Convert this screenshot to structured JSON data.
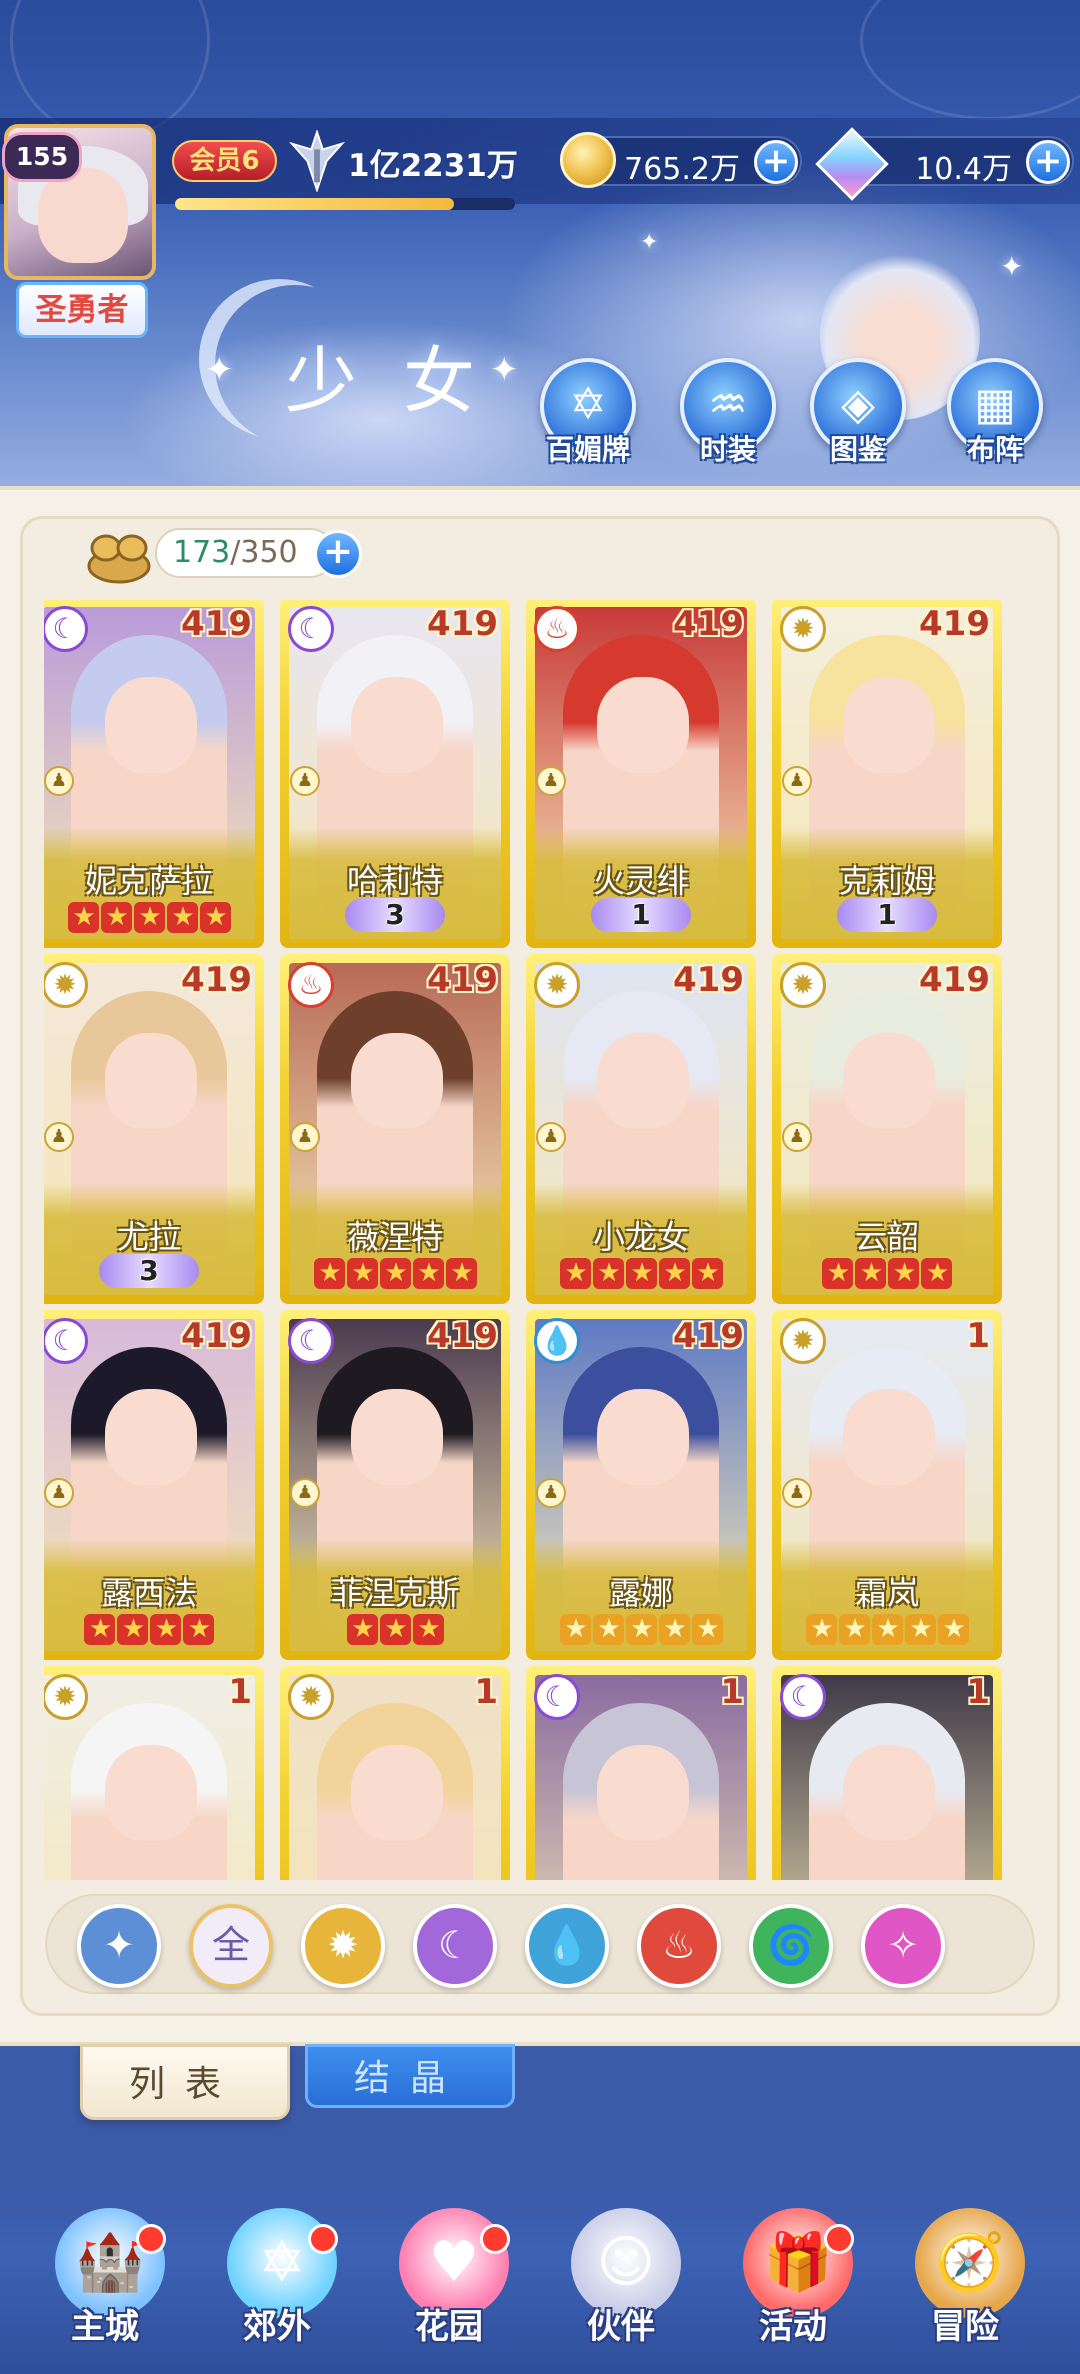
{
  "header": {
    "player_level": "155",
    "player_title": "圣勇者",
    "vip_label": "会员6",
    "power": "1亿2231万",
    "gold": "765.2万",
    "diamond": "10.4万",
    "add_symbol": "+",
    "xp_fraction": 0.82
  },
  "page_title": "少女",
  "top_nav": [
    {
      "label": "百媚牌",
      "icon": "star-badge-icon"
    },
    {
      "label": "时装",
      "icon": "dress-icon"
    },
    {
      "label": "图鉴",
      "icon": "book-icon"
    },
    {
      "label": "布阵",
      "icon": "grid-icon"
    }
  ],
  "capacity": {
    "current": "173",
    "separator": "/",
    "max": "350"
  },
  "cards": [
    {
      "name": "妮克萨拉",
      "level": "419",
      "element": "moon",
      "stars": 5,
      "star_type": "red",
      "wing": ""
    },
    {
      "name": "哈莉特",
      "level": "419",
      "element": "moon",
      "stars": 0,
      "star_type": "",
      "wing": "3"
    },
    {
      "name": "火灵绯",
      "level": "419",
      "element": "fire",
      "stars": 0,
      "star_type": "",
      "wing": "1"
    },
    {
      "name": "克莉姆",
      "level": "419",
      "element": "sun",
      "stars": 0,
      "star_type": "",
      "wing": "1"
    },
    {
      "name": "尤拉",
      "level": "419",
      "element": "sun",
      "stars": 0,
      "star_type": "",
      "wing": "3"
    },
    {
      "name": "薇涅特",
      "level": "419",
      "element": "fire",
      "stars": 5,
      "star_type": "red",
      "wing": ""
    },
    {
      "name": "小龙女",
      "level": "419",
      "element": "sun",
      "stars": 5,
      "star_type": "red",
      "wing": ""
    },
    {
      "name": "云韶",
      "level": "419",
      "element": "sun",
      "stars": 4,
      "star_type": "red",
      "wing": ""
    },
    {
      "name": "露西法",
      "level": "419",
      "element": "moon",
      "stars": 4,
      "star_type": "red",
      "wing": ""
    },
    {
      "name": "菲涅克斯",
      "level": "419",
      "element": "moon",
      "stars": 3,
      "star_type": "red",
      "wing": ""
    },
    {
      "name": "露娜",
      "level": "419",
      "element": "water",
      "stars": 5,
      "star_type": "gold",
      "wing": ""
    },
    {
      "name": "霜岚",
      "level": "1",
      "element": "sun",
      "stars": 5,
      "star_type": "gold",
      "wing": ""
    },
    {
      "name": "",
      "level": "1",
      "element": "sun",
      "stars": 0,
      "star_type": "",
      "wing": ""
    },
    {
      "name": "",
      "level": "1",
      "element": "sun",
      "stars": 0,
      "star_type": "",
      "wing": ""
    },
    {
      "name": "",
      "level": "1",
      "element": "moon",
      "stars": 0,
      "star_type": "",
      "wing": ""
    },
    {
      "name": "",
      "level": "1",
      "element": "moon",
      "stars": 0,
      "star_type": "",
      "wing": ""
    }
  ],
  "filters": [
    {
      "label": "",
      "icon": "sparkle-icon",
      "color": "#5d8fd6"
    },
    {
      "label": "全",
      "icon": "all-icon",
      "color": "#f1ecf8"
    },
    {
      "label": "",
      "icon": "sun-icon",
      "color": "#e7b53a"
    },
    {
      "label": "",
      "icon": "moon-icon",
      "color": "#a267d8"
    },
    {
      "label": "",
      "icon": "water-icon",
      "color": "#3fa3d9"
    },
    {
      "label": "",
      "icon": "fire-icon",
      "color": "#e04a3c"
    },
    {
      "label": "",
      "icon": "wind-icon",
      "color": "#3fb45c"
    },
    {
      "label": "",
      "icon": "star-orb-icon",
      "color": "#e056c4"
    }
  ],
  "tabs": [
    {
      "label": "列表",
      "active": true
    },
    {
      "label": "结晶",
      "active": false
    }
  ],
  "bottom_nav": [
    {
      "label": "主城",
      "icon": "castle-icon",
      "badge": true
    },
    {
      "label": "郊外",
      "icon": "portal-icon",
      "badge": true
    },
    {
      "label": "花园",
      "icon": "heart-icon",
      "badge": true
    },
    {
      "label": "伙伴",
      "icon": "partner-avatar-icon",
      "badge": false
    },
    {
      "label": "活动",
      "icon": "gift-icon",
      "badge": true
    },
    {
      "label": "冒险",
      "icon": "compass-icon",
      "badge": false
    }
  ],
  "colors": {
    "accent": "#1f6fe0",
    "card_gold": "#f3d02a",
    "star_red": "#d8322b",
    "star_gold": "#e9a223"
  }
}
